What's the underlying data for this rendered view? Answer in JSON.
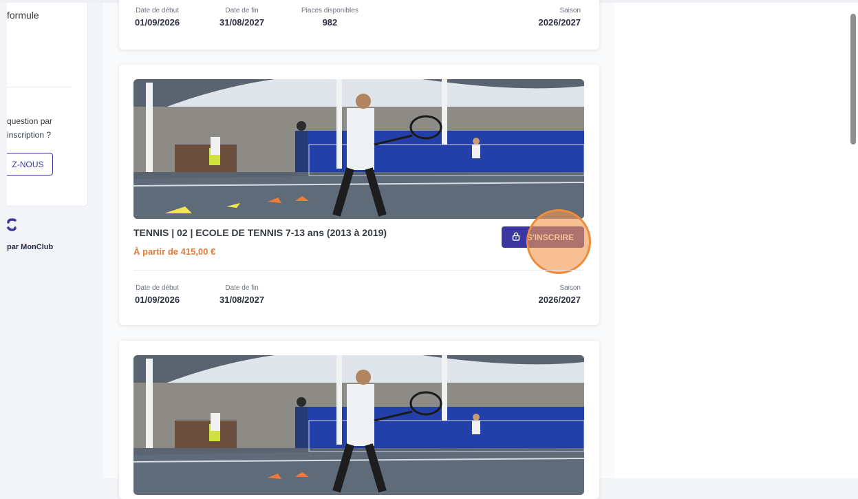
{
  "sidebar": {
    "title": "formule",
    "question_line1": "question par",
    "question_line2": "inscription ?",
    "contact_label": "Z-NOUS",
    "powered_by": "par MonClub"
  },
  "cards": [
    {
      "start_label": "Date de début",
      "start_value": "01/09/2026",
      "end_label": "Date de fin",
      "end_value": "31/08/2027",
      "places_label": "Places disponibles",
      "places_value": "982",
      "season_label": "Saison",
      "season_value": "2026/2027"
    },
    {
      "title": "TENNIS | 02 | ECOLE DE TENNIS 7-13 ans (2013 à 2019)",
      "price": "À partir de 415,00 €",
      "button_label": "S'INSCRIRE",
      "button_icon": "lock-icon",
      "start_label": "Date de début",
      "start_value": "01/09/2026",
      "end_label": "Date de fin",
      "end_value": "31/08/2027",
      "season_label": "Saison",
      "season_value": "2026/2027"
    }
  ],
  "colors": {
    "primary": "#3b36a0",
    "price": "#e07b39",
    "click_highlight": "#f29852"
  }
}
